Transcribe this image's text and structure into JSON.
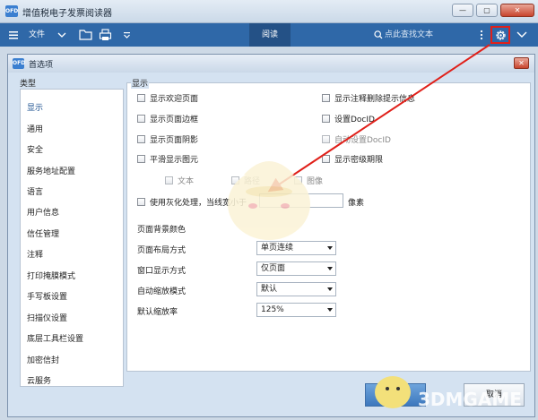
{
  "app": {
    "logo": "OFD",
    "title": "增值税电子发票阅读器",
    "window_buttons": [
      "—",
      "▢",
      "✕"
    ]
  },
  "toolbar": {
    "file_label": "文件",
    "read_tab": "阅读",
    "search_placeholder": "点此查找文本",
    "icons": [
      "menu-icon",
      "chevron-down-icon",
      "folder-icon",
      "printer-icon",
      "dropdown-icon",
      "search-icon",
      "more-icon",
      "gear-icon",
      "chevron-down-icon"
    ]
  },
  "dialog": {
    "logo": "OFD",
    "title": "首选项",
    "close": "✕",
    "categories_heading": "类型",
    "categories": [
      "显示",
      "通用",
      "安全",
      "服务地址配置",
      "语言",
      "用户信息",
      "信任管理",
      "注释",
      "打印掩膜模式",
      "手写板设置",
      "扫描仪设置",
      "底层工具栏设置",
      "加密信封",
      "云服务"
    ],
    "selected_category": "显示",
    "group_label": "显示",
    "left_checks": [
      "显示欢迎页面",
      "显示页面边框",
      "显示页面阴影",
      "平滑显示图元"
    ],
    "right_checks": [
      "显示注释删除提示信息",
      "设置DocID",
      "自动设置DocID",
      "显示密级期限"
    ],
    "smooth_options": [
      "文本",
      "路径",
      "图像"
    ],
    "gray_label": "使用灰化处理，当线宽小于",
    "gray_unit": "像素",
    "page_bg_label": "页面背景颜色",
    "layout_label": "页面布局方式",
    "layout_value": "单页连续",
    "window_label": "窗口显示方式",
    "window_value": "仅页面",
    "zoom_mode_label": "自动缩放模式",
    "zoom_mode_value": "默认",
    "zoom_label": "默认缩放率",
    "zoom_value": "125%",
    "ok_label": "确定",
    "cancel_label": "取消"
  },
  "watermark": "3DMGAME",
  "colors": {
    "toolbar": "#2f68a8",
    "annotation_red": "#e0201a",
    "ok_button": "#3d78bd"
  }
}
